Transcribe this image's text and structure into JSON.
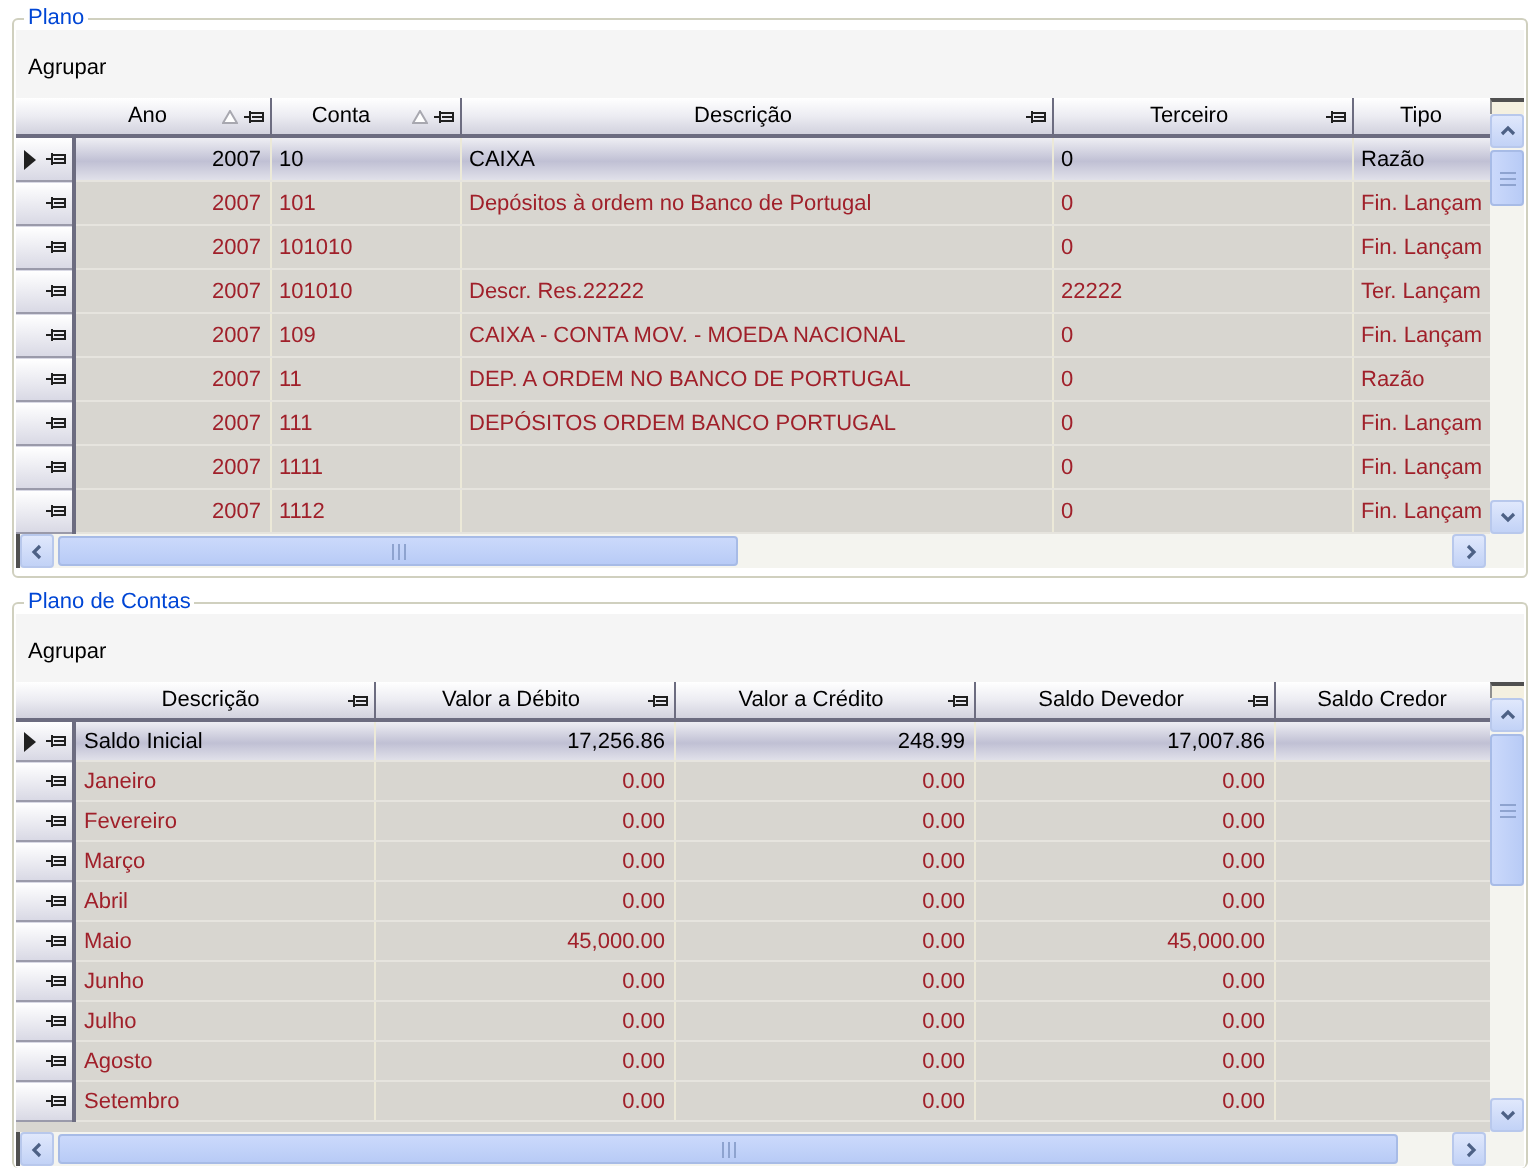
{
  "grids": [
    {
      "title": "Plano",
      "group_label": "Agrupar",
      "columns": [
        {
          "label": "Ano",
          "kind": "number",
          "sorted": true,
          "pin": true
        },
        {
          "label": "Conta",
          "kind": "text",
          "sorted": true,
          "pin": true
        },
        {
          "label": "Descrição",
          "kind": "text",
          "pin": true
        },
        {
          "label": "Terceiro",
          "kind": "text",
          "pin": true
        },
        {
          "label": "Tipo",
          "kind": "text"
        }
      ],
      "rows": [
        {
          "selected": true,
          "cells": [
            "2007",
            "10",
            "CAIXA",
            "0",
            "Razão"
          ]
        },
        {
          "selected": false,
          "cells": [
            "2007",
            "101",
            "Depósitos à ordem no Banco de Portugal",
            "0",
            "Fin. Lançam"
          ]
        },
        {
          "selected": false,
          "cells": [
            "2007",
            "101010",
            null,
            "0",
            "Fin. Lançam"
          ]
        },
        {
          "selected": false,
          "cells": [
            "2007",
            "101010",
            "Descr. Res.22222",
            "22222",
            "Ter. Lançam"
          ]
        },
        {
          "selected": false,
          "cells": [
            "2007",
            "109",
            "CAIXA - CONTA MOV. - MOEDA NACIONAL",
            "0",
            "Fin. Lançam"
          ]
        },
        {
          "selected": false,
          "cells": [
            "2007",
            "11",
            "DEP. A ORDEM NO BANCO DE PORTUGAL",
            "0",
            "Razão"
          ]
        },
        {
          "selected": false,
          "cells": [
            "2007",
            "111",
            "DEPÓSITOS  ORDEM BANCO PORTUGAL",
            "0",
            "Fin. Lançam"
          ]
        },
        {
          "selected": false,
          "cells": [
            "2007",
            "1111",
            null,
            "0",
            "Fin. Lançam"
          ]
        },
        {
          "selected": false,
          "cells": [
            "2007",
            "1112",
            null,
            "0",
            "Fin. Lançam"
          ]
        }
      ]
    },
    {
      "title": "Plano de Contas",
      "group_label": "Agrupar",
      "columns": [
        {
          "label": "Descrição",
          "kind": "text",
          "pin": true
        },
        {
          "label": "Valor a Débito",
          "kind": "number",
          "pin": true
        },
        {
          "label": "Valor a Crédito",
          "kind": "number",
          "pin": true
        },
        {
          "label": "Saldo Devedor",
          "kind": "number",
          "pin": true
        },
        {
          "label": "Saldo Credor",
          "kind": "number"
        }
      ],
      "rows": [
        {
          "selected": true,
          "cells": [
            "Saldo Inicial",
            "17,256.86",
            "248.99",
            "17,007.86",
            null
          ]
        },
        {
          "selected": false,
          "cells": [
            "Janeiro",
            "0.00",
            "0.00",
            "0.00",
            null
          ]
        },
        {
          "selected": false,
          "cells": [
            "Fevereiro",
            "0.00",
            "0.00",
            "0.00",
            null
          ]
        },
        {
          "selected": false,
          "cells": [
            "Março",
            "0.00",
            "0.00",
            "0.00",
            null
          ]
        },
        {
          "selected": false,
          "cells": [
            "Abril",
            "0.00",
            "0.00",
            "0.00",
            null
          ]
        },
        {
          "selected": false,
          "cells": [
            "Maio",
            "45,000.00",
            "0.00",
            "45,000.00",
            null
          ]
        },
        {
          "selected": false,
          "cells": [
            "Junho",
            "0.00",
            "0.00",
            "0.00",
            null
          ]
        },
        {
          "selected": false,
          "cells": [
            "Julho",
            "0.00",
            "0.00",
            "0.00",
            null
          ]
        },
        {
          "selected": false,
          "cells": [
            "Agosto",
            "0.00",
            "0.00",
            "0.00",
            null
          ]
        },
        {
          "selected": false,
          "cells": [
            "Setembro",
            "0.00",
            "0.00",
            "0.00",
            null
          ]
        }
      ]
    }
  ]
}
